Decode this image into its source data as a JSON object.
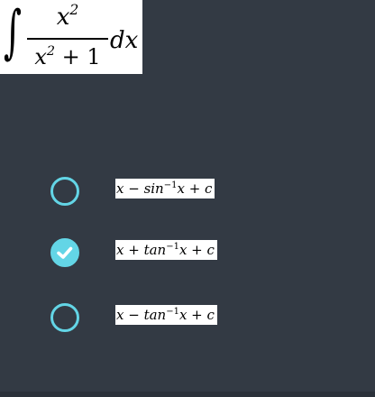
{
  "question": {
    "integral_sign": "∫",
    "numerator": "x",
    "numerator_exp": "2",
    "denominator_base": "x",
    "denominator_exp": "2",
    "denominator_rest": " + 1",
    "differential": "dx"
  },
  "options": [
    {
      "text_a": "x − sin",
      "sup": "−1",
      "text_b": "x + c",
      "checked": false
    },
    {
      "text_a": "x + tan",
      "sup": "−1",
      "text_b": "x + c",
      "checked": true
    },
    {
      "text_a": "x − tan",
      "sup": "−1",
      "text_b": "x + c",
      "checked": false
    }
  ],
  "colors": {
    "background": "#333a44",
    "accent": "#63d5e6",
    "card": "#ffffff"
  },
  "icons": {
    "selected": "check-icon"
  }
}
